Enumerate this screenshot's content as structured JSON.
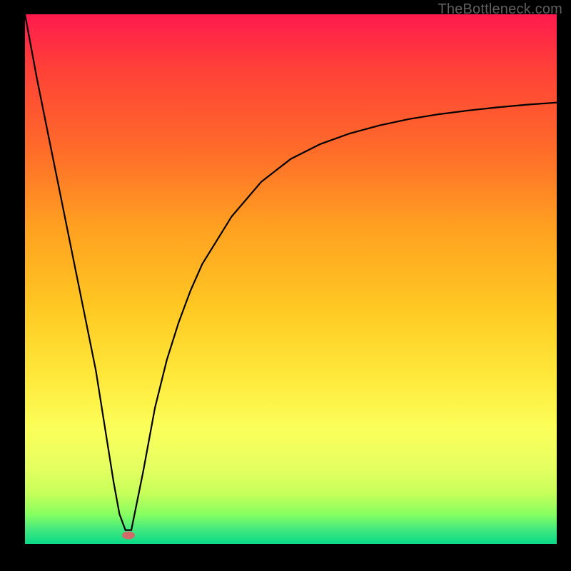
{
  "watermark": "TheBottleneck.com",
  "colors": {
    "background": "#000000",
    "dot": "#d26a6a",
    "curve": "#000000",
    "gradient_stops": [
      "#ff1a4e",
      "#ff4038",
      "#ff6a2a",
      "#ffa020",
      "#ffc822",
      "#ffe83a",
      "#fbff5a",
      "#e6ff60",
      "#c8ff5a",
      "#88ff60",
      "#40e880",
      "#00d887"
    ]
  },
  "chart_data": {
    "type": "line",
    "title": "",
    "xlabel": "",
    "ylabel": "",
    "x": [
      10,
      12,
      14,
      16,
      18,
      20,
      22,
      24,
      25,
      26,
      27,
      28,
      30,
      32,
      34,
      36,
      38,
      40,
      45,
      50,
      55,
      60,
      65,
      70,
      75,
      80,
      85,
      90,
      95,
      100
    ],
    "values": [
      100,
      88,
      77,
      66,
      55,
      44,
      33,
      19,
      12,
      6,
      3,
      3,
      14,
      26,
      35,
      42,
      48,
      53,
      62,
      68.5,
      72.8,
      75.6,
      77.6,
      79.1,
      80.3,
      81.2,
      81.9,
      82.5,
      83.0,
      83.4
    ],
    "xlim": [
      10,
      100
    ],
    "ylim": [
      0,
      100
    ],
    "minimum_point": {
      "x": 27.5,
      "y": 2
    }
  }
}
